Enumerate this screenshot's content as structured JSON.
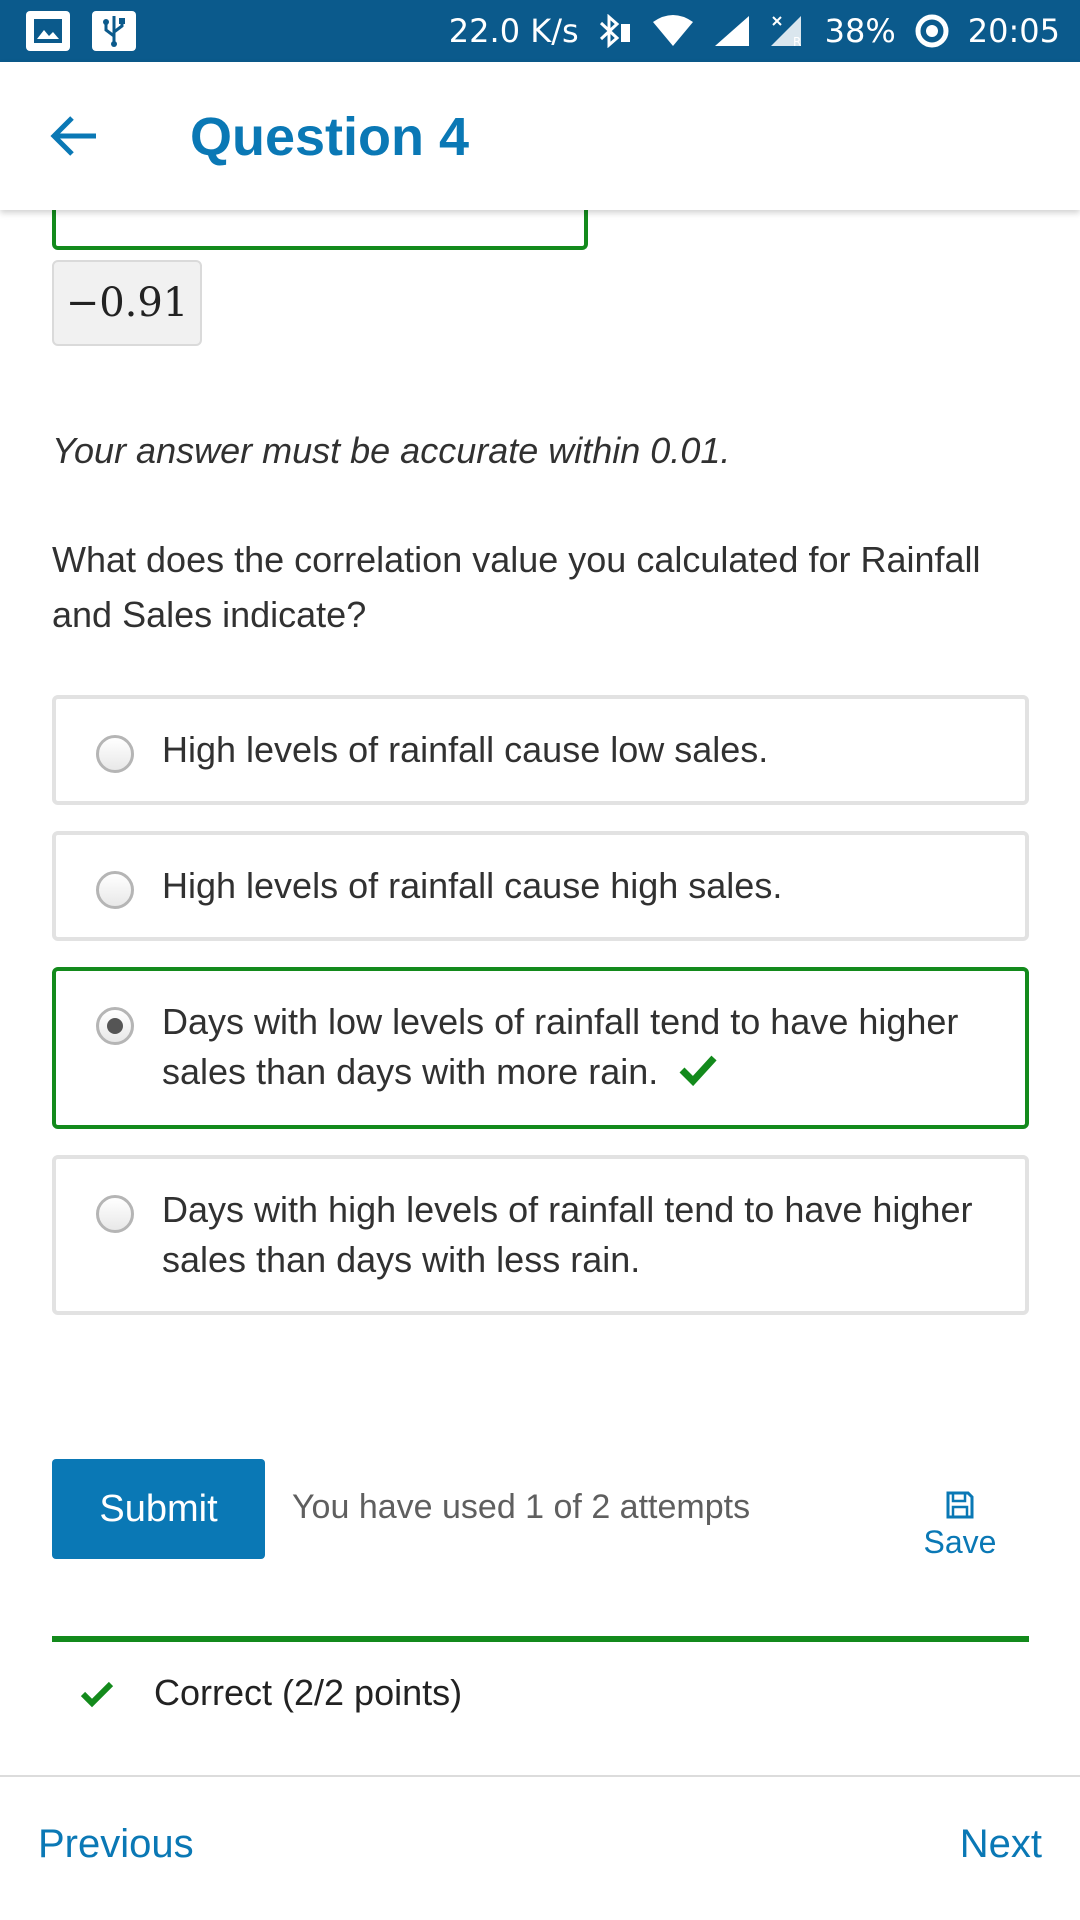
{
  "status_bar": {
    "network_speed": "22.0 K/s",
    "battery": "38%",
    "time": "20:05",
    "icons": [
      "gallery-icon",
      "usb-icon",
      "bluetooth-icon",
      "wifi-icon",
      "signal-icon",
      "roaming-signal-icon",
      "battery-ring-icon"
    ]
  },
  "header": {
    "title": "Question 4",
    "back_icon": "arrow-left-icon"
  },
  "answer": {
    "preview_value": "−0.91",
    "accuracy_note": "Your answer must be accurate within 0.01."
  },
  "question": {
    "text": "What does the correlation value you calculated for Rainfall and Sales indicate?",
    "options": [
      {
        "label": "High levels of rainfall cause low sales.",
        "selected": false
      },
      {
        "label": "High levels of rainfall cause high sales.",
        "selected": false
      },
      {
        "label": "Days with low levels of rainfall tend to have higher sales than days with more rain.",
        "selected": true,
        "correct": true
      },
      {
        "label": "Days with high levels of rainfall tend to have higher sales than days with less rain.",
        "selected": false
      }
    ]
  },
  "actions": {
    "submit_label": "Submit",
    "attempts_text": "You have used 1 of 2 attempts",
    "save_label": "Save"
  },
  "feedback": {
    "text": "Correct (2/2 points)",
    "status": "correct"
  },
  "navigation": {
    "previous_label": "Previous",
    "next_label": "Next"
  },
  "colors": {
    "status_bar": "#0b5a8c",
    "accent_blue": "#0a78b5",
    "correct_green": "#138a1c",
    "border_gray": "#e2e2e2"
  }
}
